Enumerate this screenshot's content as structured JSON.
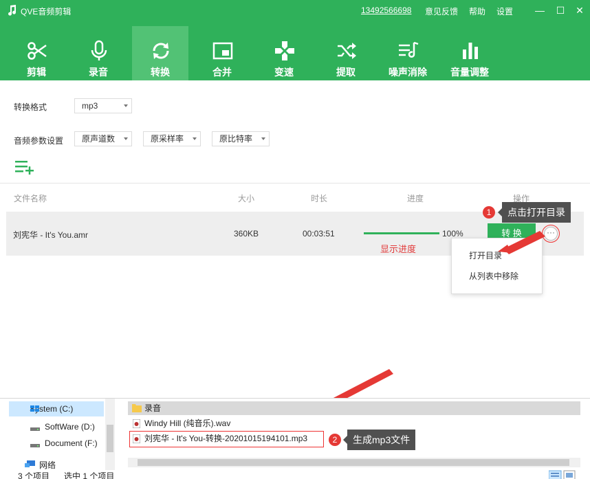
{
  "app": {
    "title": "QVE音频剪辑",
    "phone": "13492566698",
    "links": [
      "意见反馈",
      "帮助",
      "设置"
    ],
    "min_symbol": "—",
    "max_symbol": "☐",
    "close_symbol": "✕"
  },
  "toolbar": [
    {
      "label": "剪辑",
      "icon": "scissors-icon"
    },
    {
      "label": "录音",
      "icon": "microphone-icon"
    },
    {
      "label": "转换",
      "icon": "convert-icon",
      "active": true
    },
    {
      "label": "合并",
      "icon": "merge-icon"
    },
    {
      "label": "变速",
      "icon": "speed-icon"
    },
    {
      "label": "提取",
      "icon": "extract-icon"
    },
    {
      "label": "噪声消除",
      "icon": "noise-reduce-icon"
    },
    {
      "label": "音量调整",
      "icon": "volume-icon"
    }
  ],
  "settings": {
    "format_label": "转换格式",
    "format_value": "mp3",
    "params_label": "音频参数设置",
    "channel_value": "原声道数",
    "sample_value": "原采样率",
    "bitrate_value": "原比特率"
  },
  "table": {
    "headers": [
      "文件名称",
      "大小",
      "时长",
      "进度",
      "操作"
    ],
    "row": {
      "name": "刘宪华 - It's You.amr",
      "size": "360KB",
      "duration": "00:03:51",
      "progress": 1.0,
      "progress_text": "100%",
      "convert_label": "转 换",
      "more_symbol": "···"
    }
  },
  "annotations": {
    "progress_note": "显示进度",
    "badge1": "1",
    "tip1": "点击打开目录",
    "badge2": "2",
    "tip2": "生成mp3文件"
  },
  "context_menu": {
    "open_dir": "打开目录",
    "remove": "从列表中移除"
  },
  "explorer": {
    "nav": [
      {
        "label": "System (C:)",
        "selected": true
      },
      {
        "label": "SoftWare (D:)"
      },
      {
        "label": "Document (F:)"
      },
      {
        "label": "网络"
      }
    ],
    "files": [
      {
        "name": "录音",
        "type": "folder"
      },
      {
        "name": "Windy Hill (纯音乐).wav",
        "type": "audio"
      },
      {
        "name": "刘宪华 - It's You-转换-20201015194101.mp3",
        "type": "audio"
      }
    ],
    "status_count": "3 个项目",
    "status_selected": "选中 1 个项目"
  },
  "colors": {
    "brand": "#2fb15a",
    "active_tab": "#52c275",
    "annotation_red": "#e23b3b"
  }
}
